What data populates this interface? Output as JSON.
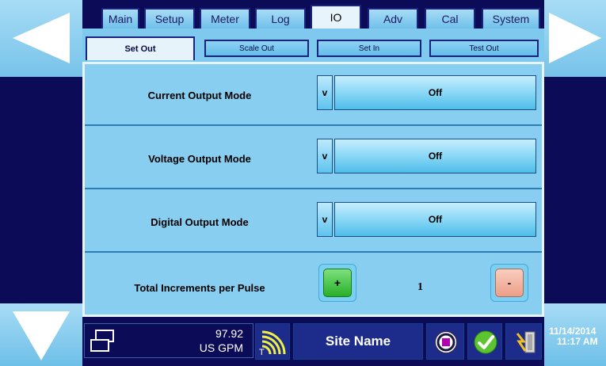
{
  "tabs": [
    {
      "label": "Main",
      "active": false
    },
    {
      "label": "Setup",
      "active": false
    },
    {
      "label": "Meter",
      "active": false
    },
    {
      "label": "Log",
      "active": false
    },
    {
      "label": "IO",
      "active": true
    },
    {
      "label": "Adv",
      "active": false
    },
    {
      "label": "Cal",
      "active": false
    },
    {
      "label": "System",
      "active": false
    }
  ],
  "subtabs": [
    {
      "label": "Set Out",
      "active": true
    },
    {
      "label": "Scale Out",
      "active": false
    },
    {
      "label": "Set In",
      "active": false
    },
    {
      "label": "Test Out",
      "active": false
    }
  ],
  "settings": [
    {
      "label": "Current Output Mode",
      "dropdown_glyph": "v",
      "value": "Off"
    },
    {
      "label": "Voltage Output Mode",
      "dropdown_glyph": "v",
      "value": "Off"
    },
    {
      "label": "Digital Output Mode",
      "dropdown_glyph": "v",
      "value": "Off"
    }
  ],
  "increments": {
    "label": "Total Increments per Pulse",
    "plus_label": "+",
    "value": "1",
    "minus_label": "-"
  },
  "status": {
    "flow_value": "97.92",
    "flow_units": "US GPM",
    "signal_label": "T",
    "site_name": "Site Name",
    "date": "11/14/2014",
    "time": "11:17 AM"
  },
  "icons": {
    "nav_left": "left-arrow-icon",
    "nav_right": "right-arrow-icon",
    "nav_down": "down-arrow-icon",
    "windows": "windows-icon",
    "signal": "signal-icon",
    "stop": "stop-icon",
    "check": "check-icon",
    "power": "power-icon"
  },
  "colors": {
    "navy": "#0b0b57",
    "panel_blue": "#87cef0",
    "plus_green": "#3cc43c",
    "minus_pink": "#f4b4a0"
  }
}
